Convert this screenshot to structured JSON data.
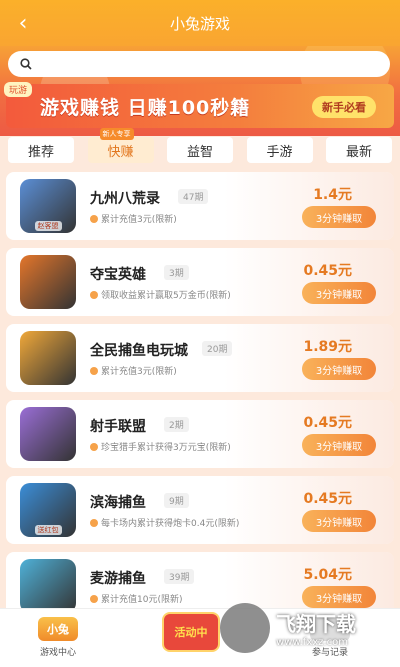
{
  "header": {
    "title": "小兔游戏"
  },
  "search": {
    "placeholder": ""
  },
  "banner": {
    "tag": "玩游",
    "text": "游戏赚钱 日赚100秒籍",
    "button": "新手必看"
  },
  "tabs": [
    {
      "label": "推荐"
    },
    {
      "label": "快赚",
      "badge": "新人专享"
    },
    {
      "label": "益智"
    },
    {
      "label": "手游"
    },
    {
      "label": "最新"
    }
  ],
  "games": [
    {
      "name": "九州八荒录",
      "tag": "47期",
      "sub": "累计充值3元(限新)",
      "price": "1.4元",
      "button": "3分钟赚取",
      "thumb_label": "赵客盟",
      "color": "#5b8fd6"
    },
    {
      "name": "夺宝英雄",
      "tag": "3期",
      "sub": "领取收益累计赢取5万金币(限新)",
      "price": "0.45元",
      "button": "3分钟赚取",
      "thumb_label": "",
      "color": "#e4762b"
    },
    {
      "name": "全民捕鱼电玩城",
      "tag": "20期",
      "sub": "累计充值3元(限新)",
      "price": "1.89元",
      "button": "3分钟赚取",
      "thumb_label": "",
      "color": "#f0a83a"
    },
    {
      "name": "射手联盟",
      "tag": "2期",
      "sub": "珍宝猎手累计获得3万元宝(限新)",
      "price": "0.45元",
      "button": "3分钟赚取",
      "thumb_label": "",
      "color": "#9a6ed6"
    },
    {
      "name": "滨海捕鱼",
      "tag": "9期",
      "sub": "每卡场内累计获得炮卡0.4元(限新)",
      "price": "0.45元",
      "button": "3分钟赚取",
      "thumb_label": "送红包",
      "color": "#3b8ed8"
    },
    {
      "name": "麦游捕鱼",
      "tag": "39期",
      "sub": "累计充值10元(限新)",
      "price": "5.04元",
      "button": "3分钟赚取",
      "thumb_label": "",
      "color": "#4fb1d8"
    }
  ],
  "bottom_nav": {
    "left_label": "游戏中心",
    "left_icon_text": "小兔",
    "right_label": "参与记录",
    "center_label": "活动中"
  },
  "watermark": {
    "cn": "飞翔下载",
    "en": "www.fxxz.com"
  },
  "colors": {
    "header": "#fbb02a",
    "accent": "#e57a22",
    "button": "#f28539"
  }
}
